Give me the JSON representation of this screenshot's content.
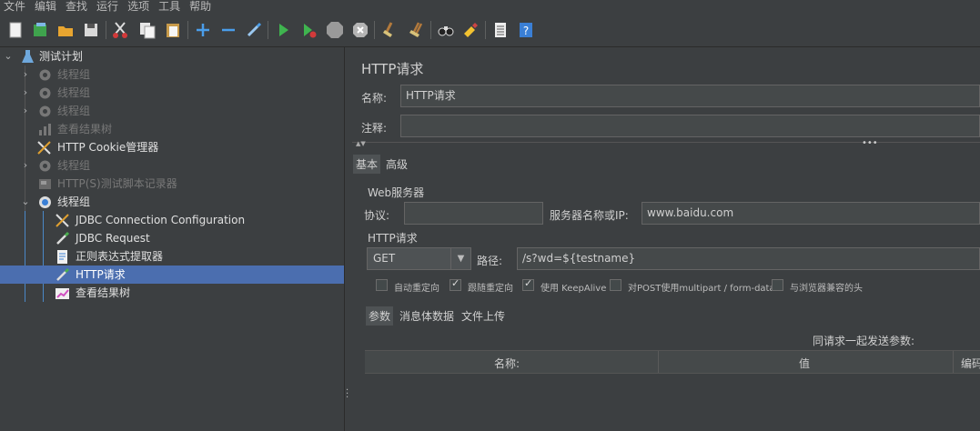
{
  "menu": [
    "文件",
    "编辑",
    "查找",
    "运行",
    "选项",
    "工具",
    "帮助"
  ],
  "toolbar": {
    "icons": [
      "new-icon",
      "templates-icon",
      "open-icon",
      "save-icon",
      "cut-icon",
      "copy-icon",
      "paste-icon",
      "expand-icon",
      "collapse-icon",
      "toggle-icon",
      "start-icon",
      "start-no-pause-icon",
      "stop-icon",
      "shutdown-icon",
      "clear-icon",
      "clear-all-icon",
      "search-icon",
      "reset-search-icon",
      "function-helper-icon",
      "help-icon"
    ]
  },
  "tree": {
    "root": "测试计划",
    "items": [
      {
        "label": "线程组",
        "state": "disabled"
      },
      {
        "label": "线程组",
        "state": "disabled"
      },
      {
        "label": "线程组",
        "state": "disabled"
      },
      {
        "label": "查看结果树",
        "state": "disabled"
      },
      {
        "label": "HTTP Cookie管理器",
        "state": "enabled"
      },
      {
        "label": "线程组",
        "state": "disabled"
      },
      {
        "label": "HTTP(S)测试脚本记录器",
        "state": "disabled"
      },
      {
        "label": "线程组",
        "state": "enabled"
      }
    ],
    "children": [
      {
        "label": "JDBC Connection Configuration"
      },
      {
        "label": "JDBC Request"
      },
      {
        "label": "正则表达式提取器"
      },
      {
        "label": "HTTP请求",
        "selected": true
      },
      {
        "label": "查看结果树"
      }
    ]
  },
  "panel": {
    "title": "HTTP请求",
    "name_label": "名称:",
    "name_value": "HTTP请求",
    "comment_label": "注释:",
    "comment_value": "",
    "tabs": [
      "基本",
      "高级"
    ],
    "web_server": {
      "title": "Web服务器",
      "protocol_label": "协议:",
      "protocol_value": "",
      "server_label": "服务器名称或IP:",
      "server_value": "www.baidu.com"
    },
    "http_request": {
      "title": "HTTP请求",
      "method": "GET",
      "path_label": "路径:",
      "path_value": "/s?wd=${testname}"
    },
    "options": [
      {
        "label": "自动重定向",
        "checked": false
      },
      {
        "label": "跟随重定向",
        "checked": true
      },
      {
        "label": "使用 KeepAlive",
        "checked": true
      },
      {
        "label": "对POST使用multipart / form-data",
        "checked": false
      },
      {
        "label": "与浏览器兼容的头",
        "checked": false
      }
    ],
    "sub_tabs": [
      "参数",
      "消息体数据",
      "文件上传"
    ],
    "params_caption": "同请求一起发送参数:",
    "columns": [
      "名称:",
      "值",
      "编码"
    ]
  }
}
